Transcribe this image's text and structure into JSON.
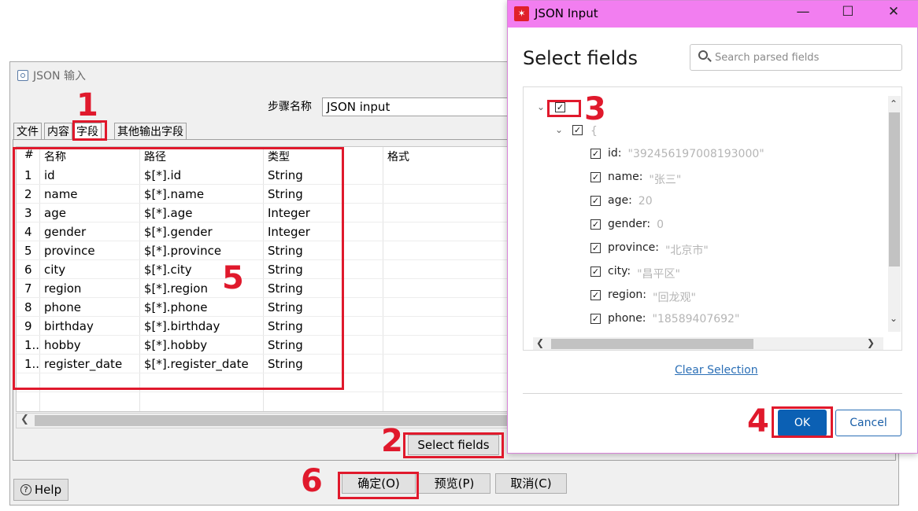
{
  "bg_dialog": {
    "title": "JSON 输入",
    "step_label": "步骤名称",
    "step_value": "JSON input",
    "tabs": [
      "文件",
      "内容",
      "字段",
      "其他输出字段"
    ],
    "columns": [
      "#",
      "名称",
      "路径",
      "类型",
      "格式"
    ],
    "rows": [
      {
        "num": "1",
        "name": "id",
        "path": "$[*].id",
        "type": "String"
      },
      {
        "num": "2",
        "name": "name",
        "path": "$[*].name",
        "type": "String"
      },
      {
        "num": "3",
        "name": "age",
        "path": "$[*].age",
        "type": "Integer"
      },
      {
        "num": "4",
        "name": "gender",
        "path": "$[*].gender",
        "type": "Integer"
      },
      {
        "num": "5",
        "name": "province",
        "path": "$[*].province",
        "type": "String"
      },
      {
        "num": "6",
        "name": "city",
        "path": "$[*].city",
        "type": "String"
      },
      {
        "num": "7",
        "name": "region",
        "path": "$[*].region",
        "type": "String"
      },
      {
        "num": "8",
        "name": "phone",
        "path": "$[*].phone",
        "type": "String"
      },
      {
        "num": "9",
        "name": "birthday",
        "path": "$[*].birthday",
        "type": "String"
      },
      {
        "num": "1..",
        "name": "hobby",
        "path": "$[*].hobby",
        "type": "String"
      },
      {
        "num": "1..",
        "name": "register_date",
        "path": "$[*].register_date",
        "type": "String"
      }
    ],
    "select_fields_label": "Select fields",
    "ok_label": "确定(O)",
    "preview_label": "预览(P)",
    "cancel_label": "取消(C)",
    "help_label": "Help"
  },
  "json_window": {
    "title": "JSON Input",
    "heading": "Select fields",
    "search_placeholder": "Search parsed fields",
    "root_brace": "{",
    "fields": [
      {
        "key": "id:",
        "value": "\"392456197008193000\""
      },
      {
        "key": "name:",
        "value": "\"张三\""
      },
      {
        "key": "age:",
        "value": "20"
      },
      {
        "key": "gender:",
        "value": "0"
      },
      {
        "key": "province:",
        "value": "\"北京市\""
      },
      {
        "key": "city:",
        "value": "\"昌平区\""
      },
      {
        "key": "region:",
        "value": "\"回龙观\""
      },
      {
        "key": "phone:",
        "value": "\"18589407692\""
      }
    ],
    "clear_selection": "Clear Selection",
    "ok_label": "OK",
    "cancel_label": "Cancel"
  },
  "annotations": [
    "1",
    "2",
    "3",
    "4",
    "5",
    "6"
  ],
  "colors": {
    "annotation": "#e0192c",
    "titlebar": "#f27ef0",
    "ok_button": "#0b60b4",
    "link": "#2b6fb6"
  }
}
